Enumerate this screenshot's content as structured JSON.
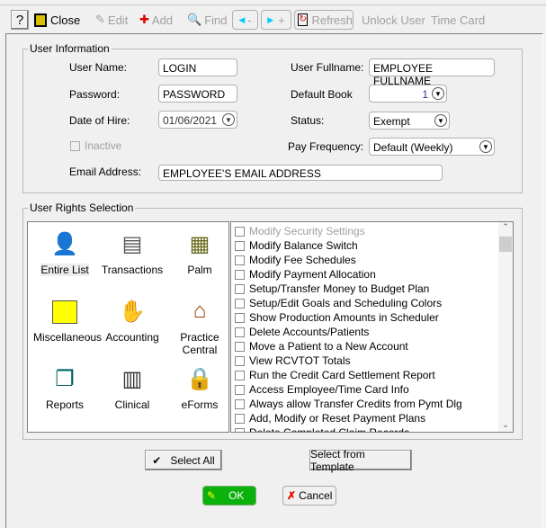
{
  "toolbar": {
    "help": "?",
    "close": "Close",
    "edit": "Edit",
    "add": "Add",
    "find": "Find",
    "prev": "-",
    "next": "+",
    "refresh": "Refresh",
    "unlock": "Unlock User",
    "timecard": "Time Card"
  },
  "user_info": {
    "title": "User Information",
    "user_name_label": "User Name:",
    "user_name": "LOGIN",
    "password_label": "Password:",
    "password": "PASSWORD",
    "hire_label": "Date of Hire:",
    "hire": "01/06/2021",
    "inactive_label": "Inactive",
    "email_label": "Email Address:",
    "email": "EMPLOYEE'S EMAIL ADDRESS",
    "fullname_label": "User Fullname:",
    "fullname": "EMPLOYEE FULLNAME",
    "book_label": "Default Book",
    "book": "1",
    "status_label": "Status:",
    "status": "Exempt",
    "payfreq_label": "Pay Frequency:",
    "payfreq": "Default (Weekly)"
  },
  "rights": {
    "title": "User Rights Selection",
    "categories": [
      {
        "label": "Entire List",
        "icon": "person-icon"
      },
      {
        "label": "Transactions",
        "icon": "register-icon"
      },
      {
        "label": "Palm",
        "icon": "pda-icon"
      },
      {
        "label": "Miscellaneous",
        "icon": "folder-icon"
      },
      {
        "label": "Accounting",
        "icon": "calculator-icon"
      },
      {
        "label": "Practice Central",
        "icon": "house-icon"
      },
      {
        "label": "Reports",
        "icon": "reports-icon"
      },
      {
        "label": "Clinical",
        "icon": "chart-icon"
      },
      {
        "label": "eForms",
        "icon": "clipboard-lock-icon"
      }
    ],
    "items": [
      "Modify Security Settings",
      "Modify Balance Switch",
      "Modify Fee Schedules",
      "Modify Payment Allocation",
      "Setup/Transfer Money to Budget Plan",
      "Setup/Edit Goals and Scheduling Colors",
      "Show Production Amounts in Scheduler",
      "Delete Accounts/Patients",
      "Move a Patient to a New Account",
      "View RCVTOT Totals",
      "Run the Credit Card Settlement Report",
      "Access Employee/Time Card Info",
      "Always allow Transfer Credits from Pymt Dlg",
      "Add, Modify or Reset Payment Plans",
      "Delete Completed Claim Records"
    ]
  },
  "buttons": {
    "select_all": "Select All",
    "template": "Select from Template",
    "ok": "OK",
    "cancel": "Cancel"
  },
  "colors": {
    "ok_green": "#0cb20c"
  }
}
